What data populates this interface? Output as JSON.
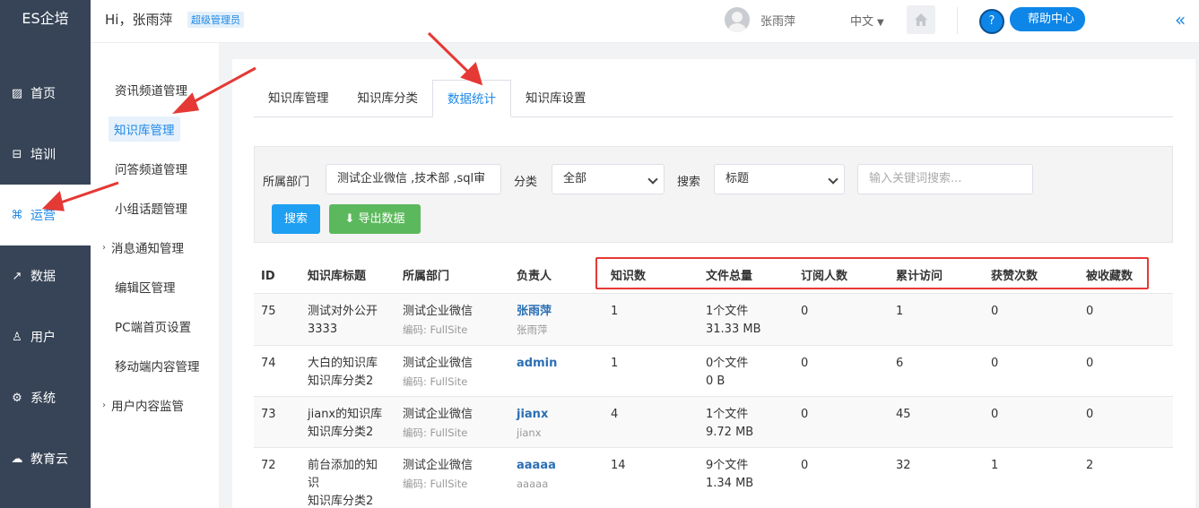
{
  "brand": "ES企培",
  "header": {
    "greeting": "Hi，张雨萍",
    "role": "超级管理员",
    "user_name": "张雨萍",
    "language": "中文",
    "help": "帮助中心"
  },
  "leftnav": [
    {
      "label": "首页",
      "icon": "dashboard-icon"
    },
    {
      "label": "培训",
      "icon": "training-icon"
    },
    {
      "label": "运营",
      "icon": "operations-icon"
    },
    {
      "label": "数据",
      "icon": "chart-icon"
    },
    {
      "label": "用户",
      "icon": "user-icon"
    },
    {
      "label": "系统",
      "icon": "gear-icon"
    },
    {
      "label": "教育云",
      "icon": "cloud-icon"
    }
  ],
  "subnav": [
    {
      "label": "资讯频道管理"
    },
    {
      "label": "知识库管理"
    },
    {
      "label": "问答频道管理"
    },
    {
      "label": "小组话题管理"
    },
    {
      "label": "消息通知管理"
    },
    {
      "label": "编辑区管理"
    },
    {
      "label": "PC端首页设置"
    },
    {
      "label": "移动端内容管理"
    },
    {
      "label": "用户内容监管"
    }
  ],
  "tabs": [
    {
      "label": "知识库管理"
    },
    {
      "label": "知识库分类"
    },
    {
      "label": "数据统计"
    },
    {
      "label": "知识库设置"
    }
  ],
  "filter": {
    "dept_label": "所属部门",
    "dept_value": "测试企业微信 ,技术部 ,sql审",
    "category_label": "分类",
    "category_value": "全部",
    "search_label": "搜索",
    "search_field": "标题",
    "keyword_placeholder": "输入关键词搜索...",
    "search_button": "搜索",
    "export_button": "导出数据"
  },
  "table": {
    "headers": [
      "ID",
      "知识库标题",
      "所属部门",
      "负责人",
      "知识数",
      "文件总量",
      "订阅人数",
      "累计访问",
      "获赞次数",
      "被收藏数"
    ],
    "rows": [
      {
        "id": "75",
        "title": "测试对外公开",
        "title2": "3333",
        "dept": "测试企业微信",
        "code": "编码: FullSite",
        "owner": "张雨萍",
        "owner_sub": "张雨萍",
        "knowledge": "1",
        "files": "1个文件",
        "size": "31.33 MB",
        "subs": "0",
        "visits": "1",
        "likes": "0",
        "favs": "0"
      },
      {
        "id": "74",
        "title": "大白的知识库",
        "title2": "知识库分类2",
        "dept": "测试企业微信",
        "code": "编码: FullSite",
        "owner": "admin",
        "owner_sub": "",
        "knowledge": "1",
        "files": "0个文件",
        "size": "0 B",
        "subs": "0",
        "visits": "6",
        "likes": "0",
        "favs": "0"
      },
      {
        "id": "73",
        "title": "jianx的知识库",
        "title2": "知识库分类2",
        "dept": "测试企业微信",
        "code": "编码: FullSite",
        "owner": "jianx",
        "owner_sub": "jianx",
        "knowledge": "4",
        "files": "1个文件",
        "size": "9.72 MB",
        "subs": "0",
        "visits": "45",
        "likes": "0",
        "favs": "0"
      },
      {
        "id": "72",
        "title": "前台添加的知",
        "title2": "识",
        "title3": "知识库分类2",
        "dept": "测试企业微信",
        "code": "编码: FullSite",
        "owner": "aaaaa",
        "owner_sub": "aaaaa",
        "knowledge": "14",
        "files": "9个文件",
        "size": "1.34 MB",
        "subs": "0",
        "visits": "32",
        "likes": "1",
        "favs": "2"
      }
    ]
  },
  "colors": {
    "sidebar": "#374457",
    "accent": "#1e88e5",
    "annotation": "#e53935"
  }
}
